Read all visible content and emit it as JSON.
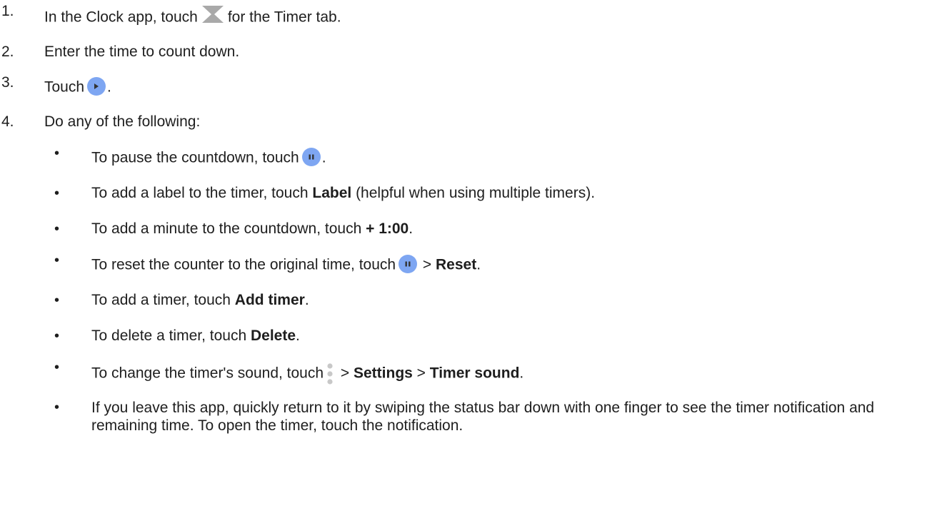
{
  "steps": [
    {
      "number": "1.",
      "before": "In the Clock app, touch",
      "icon": "hourglass-icon",
      "after": "for the Timer tab."
    },
    {
      "number": "2.",
      "text": "Enter the time to count down."
    },
    {
      "number": "3.",
      "before": "Touch",
      "icon": "play-button-icon",
      "after": "."
    },
    {
      "number": "4.",
      "text": "Do any of the following:"
    }
  ],
  "bullets": [
    {
      "before": "To pause the countdown, touch",
      "icon": "pause-button-icon",
      "after": "."
    },
    {
      "before": "To add a label to the timer, touch ",
      "bold": "Label",
      "after": " (helpful when using multiple timers)."
    },
    {
      "before": "To add a minute to the countdown, touch ",
      "bold": "+ 1:00",
      "after": "."
    },
    {
      "before": "To reset the counter to the original time, touch",
      "icon": "pause-button-icon",
      "mid": " > ",
      "bold": "Reset",
      "after": "."
    },
    {
      "before": "To add a timer, touch ",
      "bold": "Add timer",
      "after": "."
    },
    {
      "before": "To delete a timer, touch ",
      "bold": "Delete",
      "after": "."
    },
    {
      "before": "To change the timer's sound, touch",
      "icon": "more-vert-icon",
      "mid": " > ",
      "bold": "Settings",
      "mid2": " > ",
      "bold2": "Timer sound",
      "after": "."
    },
    {
      "text": "If you leave this app, quickly return to it by swiping the status bar down with one finger to see the timer notification and remaining time. To open the timer, touch the notification."
    }
  ],
  "bullet_char": "•",
  "colors": {
    "text": "#1e1e1e",
    "button_blue": "#7ea6f2",
    "hourglass_gray": "#a9a9a9",
    "kebab_gray": "#c8c8c8"
  }
}
